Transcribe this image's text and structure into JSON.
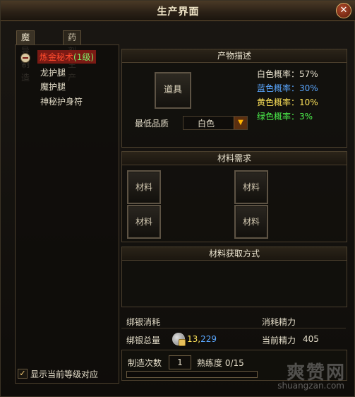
{
  "window": {
    "title": "生产界面"
  },
  "tabs": [
    {
      "label": "魔导制造",
      "active": true
    },
    {
      "label": "药剂生产",
      "active": false
    }
  ],
  "recipes": [
    {
      "name": "炼金秘术",
      "level": "(1级)",
      "selected": true
    },
    {
      "name": "龙护腿",
      "level": "",
      "selected": false
    },
    {
      "name": "魔护腿",
      "level": "",
      "selected": false
    },
    {
      "name": "神秘护身符",
      "level": "",
      "selected": false
    }
  ],
  "product": {
    "section_title": "产物描述",
    "slot_label": "道具",
    "min_quality_label": "最低品质",
    "min_quality_value": "白色",
    "probabilities": [
      {
        "label": "白色概率：57%",
        "color": "#e9e2cf"
      },
      {
        "label": "蓝色概率：30%",
        "color": "#5aa7ff"
      },
      {
        "label": "黄色概率：10%",
        "color": "#ffe45a"
      },
      {
        "label": "绿色概率：3%",
        "color": "#4cf04c"
      }
    ]
  },
  "materials": {
    "section_title": "材料需求",
    "slots": [
      "材料",
      "材料",
      "材料",
      "材料"
    ]
  },
  "acquire": {
    "section_title": "材料获取方式"
  },
  "costs": {
    "bound_silver_cost_label": "绑银消耗",
    "energy_cost_label": "消耗精力",
    "bound_silver_total_label": "绑银总量",
    "bound_silver_total_part1": "13,",
    "bound_silver_total_part2": "229",
    "current_energy_label": "当前精力",
    "current_energy_value": "405"
  },
  "craft": {
    "count_label": "制造次数",
    "count_value": "1",
    "proficiency_label": "熟练度 0/15",
    "proficiency_fraction": 0.0
  },
  "options": {
    "show_level_label": "显示当前等级对应",
    "checked": true
  },
  "watermark": {
    "text_cn": "爽赞网",
    "text_url": "shuangzan.com"
  }
}
